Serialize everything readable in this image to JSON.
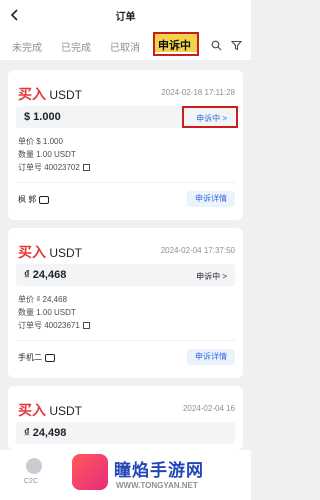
{
  "header": {
    "title": "订单"
  },
  "tabs": [
    {
      "label": "未完成"
    },
    {
      "label": "已完成"
    },
    {
      "label": "已取消"
    },
    {
      "label": "申诉中"
    }
  ],
  "orders": [
    {
      "side": "买入",
      "asset": "USDT",
      "time": "2024-02-18 17:11:28",
      "amount": "$ 1.000",
      "status": "申诉中 >",
      "unit_price": "单价 $ 1.000",
      "quantity": "数量 1.00 USDT",
      "order_no": "订单号 40023702",
      "counterparty": "枫 郭",
      "detail_label": "申诉详情"
    },
    {
      "side": "买入",
      "asset": "USDT",
      "time": "2024-02-04 17:37:50",
      "amount": "₫ 24,468",
      "status": "申诉中 >",
      "unit_price": "单价 ₫ 24,468",
      "quantity": "数量 1.00 USDT",
      "order_no": "订单号 40023671",
      "counterparty": "手机二",
      "detail_label": "申诉详情"
    },
    {
      "side": "买入",
      "asset": "USDT",
      "time": "2024-02-04 16",
      "amount": "₫ 24,498"
    }
  ],
  "bottom_nav": {
    "label": "C2C"
  },
  "watermark": {
    "name": "瞳焰手游网",
    "url": "WWW.TONGYAN.NET"
  }
}
